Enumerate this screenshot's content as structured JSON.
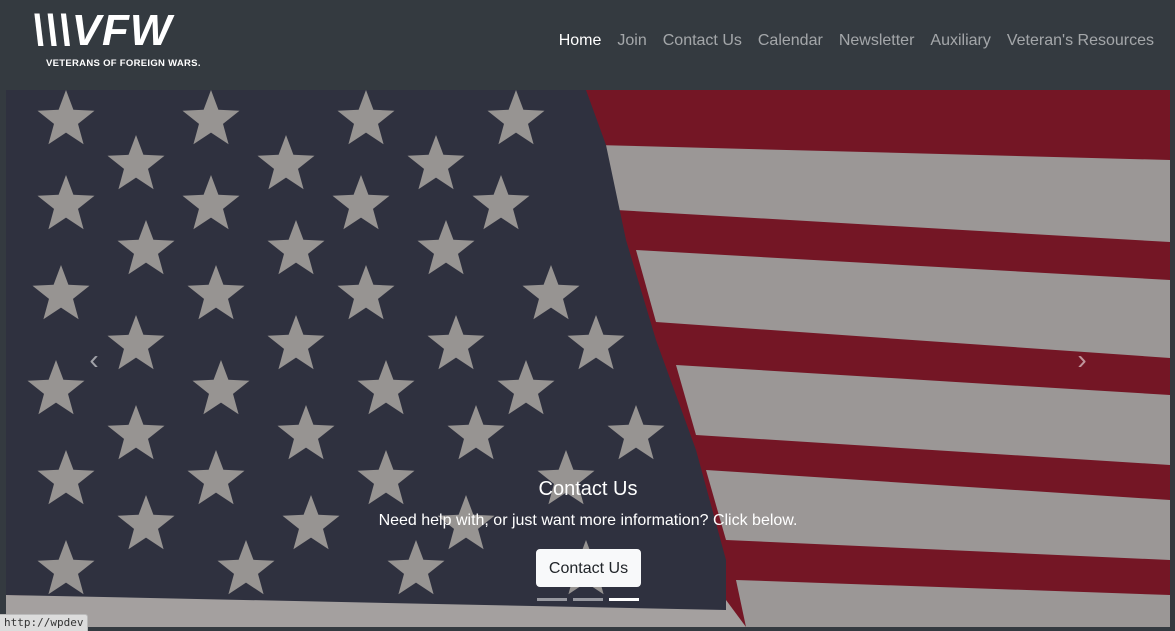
{
  "logo": {
    "mark": "\\\\\\VFW",
    "subtitle": "VETERANS OF FOREIGN WARS."
  },
  "nav": {
    "items": [
      "Home",
      "Join",
      "Contact Us",
      "Calendar",
      "Newsletter",
      "Auxiliary",
      "Veteran's Resources"
    ],
    "active": "Home"
  },
  "carousel": {
    "prev_icon": "chevron-left-icon",
    "next_icon": "chevron-right-icon",
    "slide": {
      "title": "Contact Us",
      "text": "Need help with, or just want more information? Click below.",
      "button_label": "Contact Us"
    },
    "indicator_count": 3,
    "active_indicator": 3
  },
  "status_bar": {
    "url": "http://wpdev"
  },
  "colors": {
    "navbar": "#343a40",
    "flag_blue": "#3a3c4e",
    "flag_red": "#8e1c2e",
    "flag_white": "#bdb9b8",
    "star": "#b9b5b2"
  }
}
